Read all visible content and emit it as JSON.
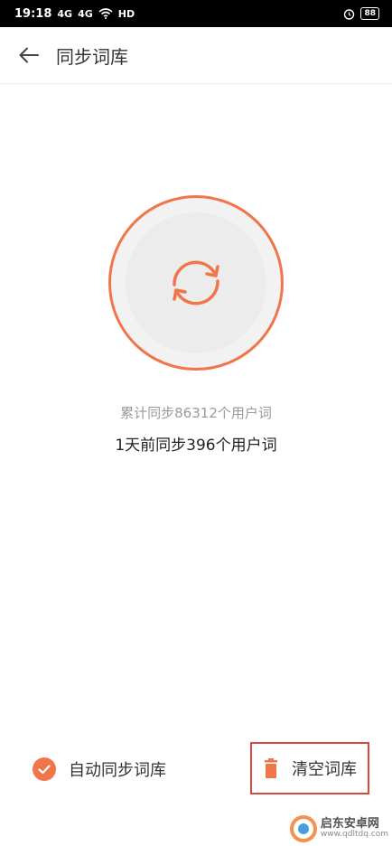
{
  "statusbar": {
    "time": "19:18",
    "signal1": "4G",
    "signal2": "4G",
    "wifi": "wifi-icon",
    "hd": "HD",
    "alarm": "alarm-icon",
    "battery": "88"
  },
  "header": {
    "title": "同步词库"
  },
  "sync": {
    "total_text": "累计同步86312个用户词",
    "recent_text": "1天前同步396个用户词"
  },
  "actions": {
    "auto_sync_label": "自动同步词库",
    "clear_label": "清空词库"
  },
  "watermark": {
    "title": "启东安卓网",
    "url": "www.qdltdq.com"
  },
  "colors": {
    "accent": "#f0764a",
    "highlight_border": "#d9473f"
  }
}
